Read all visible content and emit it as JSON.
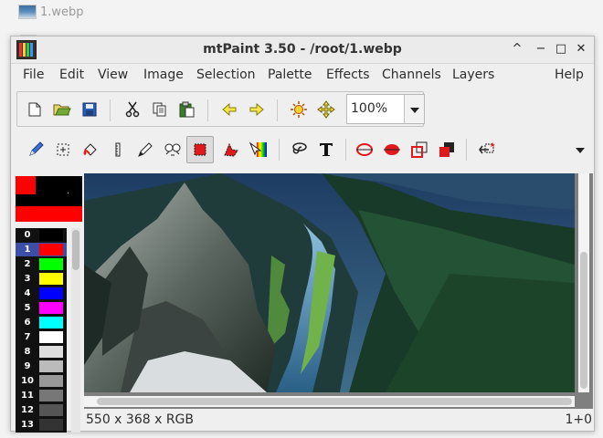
{
  "desktop": {
    "file_label": "1.webp"
  },
  "window": {
    "title": "mtPaint 3.50 - /root/1.webp",
    "controls": [
      "^",
      "−",
      "□",
      "✕"
    ]
  },
  "menu": [
    "File",
    "Edit",
    "View",
    "Image",
    "Selection",
    "Palette",
    "Effects",
    "Channels",
    "Layers",
    "Help"
  ],
  "toolbar_main": {
    "buttons": [
      "new-icon",
      "open-icon",
      "save-icon",
      "cut-icon",
      "copy-icon",
      "paste-icon",
      "undo-icon",
      "redo-icon",
      "transform-colour-icon",
      "pan-icon"
    ],
    "zoom_value": "100%"
  },
  "toolbar_tools": {
    "buttons": [
      "paint-icon",
      "shuffle-icon",
      "flood-fill-icon",
      "straight-line-icon",
      "smudge-icon",
      "clone-icon",
      "rect-select-icon",
      "polygon-select-icon",
      "gradient-icon",
      "lasso-icon",
      "text-icon",
      "outline-ellipse-icon",
      "fill-ellipse-icon",
      "outline-rect-icon",
      "fill-rect-icon",
      "flip-select-icon",
      "dropdown-icon"
    ]
  },
  "palette": {
    "colors": [
      {
        "index": "0",
        "hex": "#000000"
      },
      {
        "index": "1",
        "hex": "#ff0000"
      },
      {
        "index": "2",
        "hex": "#00ff00"
      },
      {
        "index": "3",
        "hex": "#ffff00"
      },
      {
        "index": "4",
        "hex": "#0000ff"
      },
      {
        "index": "5",
        "hex": "#ff00ff"
      },
      {
        "index": "6",
        "hex": "#00ffff"
      },
      {
        "index": "7",
        "hex": "#ffffff"
      },
      {
        "index": "8",
        "hex": "#dddddd"
      },
      {
        "index": "9",
        "hex": "#bbbbbb"
      },
      {
        "index": "10",
        "hex": "#999999"
      },
      {
        "index": "11",
        "hex": "#777777"
      },
      {
        "index": "12",
        "hex": "#555555"
      },
      {
        "index": "13",
        "hex": "#333333"
      }
    ],
    "selected_index": "1",
    "accent": "#ff0000"
  },
  "status": {
    "image_info": "550 x 368 x RGB",
    "cursor": "1+0"
  }
}
